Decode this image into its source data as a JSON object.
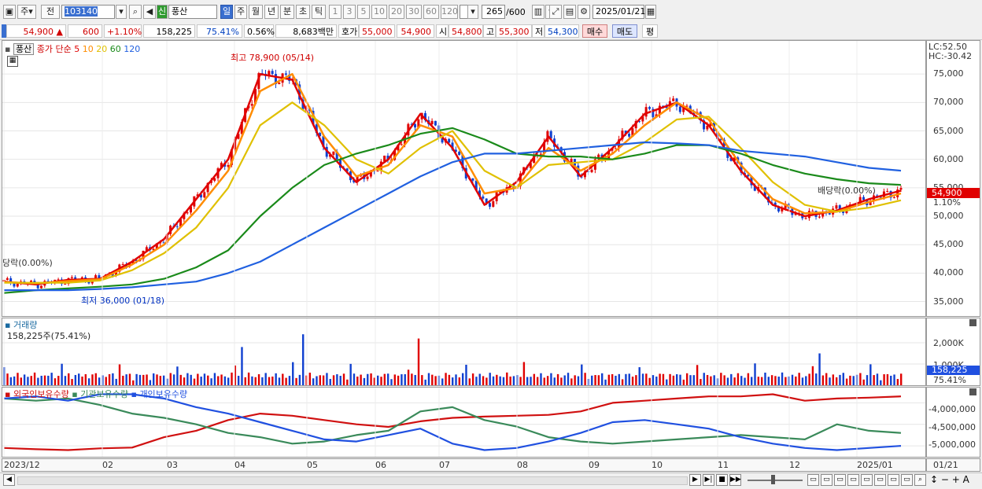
{
  "toolbar": {
    "market": "주",
    "period_prefix": "전",
    "stock_code": "103140",
    "new_badge": "신",
    "stock_name": "풍산",
    "periods": [
      "일",
      "주",
      "월",
      "년",
      "분",
      "초",
      "틱"
    ],
    "selected_period": "일",
    "intervals": [
      "1",
      "3",
      "5",
      "10",
      "20",
      "30",
      "60",
      "120"
    ],
    "count_display": "265",
    "count_total": "/600",
    "date": "2025/01/21"
  },
  "quote": {
    "price": "54,900",
    "change": "600",
    "change_pct": "+1.10%",
    "volume": "158,225",
    "volume_ratio": "75.41%",
    "turnover_pct": "0.56%",
    "amount": "8,683",
    "amount_unit": "백만",
    "ask_label": "호가",
    "ask1": "55,000",
    "ask2": "54,900",
    "open_label": "시",
    "open": "54,800",
    "high_label": "고",
    "high": "55,300",
    "low_label": "저",
    "low": "54,300",
    "buy_button": "매수",
    "sell_button": "매도",
    "eval_button": "평"
  },
  "price_panel": {
    "name_tag": "풍산",
    "legend_prefix": "종가 단순",
    "ma_periods": [
      "5",
      "10",
      "20",
      "60",
      "120"
    ],
    "ma_colors": [
      "#e00000",
      "#ff8c00",
      "#e0c000",
      "#1a8a1a",
      "#2060e0"
    ],
    "lc": "LC:52.50",
    "hc": "HC:-30.42",
    "high_annotation": "최고 78,900 (05/14)",
    "low_annotation": "최저 36,000 (01/18)",
    "dividend_left": "당락(0.00%)",
    "dividend_right": "배당락(0.00%)",
    "current_price_tag": "54,900",
    "current_pct_tag": "1.10%",
    "y_ticks": [
      "75,000",
      "70,000",
      "65,000",
      "60,000",
      "55,000",
      "50,000",
      "45,000",
      "40,000",
      "35,000"
    ]
  },
  "volume_panel": {
    "title": "거래량",
    "subtitle": "158,225주(75.41%)",
    "y_ticks": [
      "2,000K",
      "1,000K"
    ],
    "value_tag": "158,225",
    "pct_tag": "75.41%"
  },
  "holdings_panel": {
    "legend": [
      "외국인보유수량",
      "기관보유수량",
      "개인보유수량"
    ],
    "colors": [
      "#d01010",
      "#3a8a5a",
      "#2050e0"
    ],
    "y_ticks": [
      "-4,000,000",
      "-4,500,000",
      "-5,000,000"
    ]
  },
  "x_axis": {
    "labels": [
      "2023/12",
      "02",
      "03",
      "04",
      "05",
      "06",
      "07",
      "08",
      "09",
      "10",
      "11",
      "12",
      "2025/01"
    ],
    "right_label": "01/21"
  },
  "chart_data": {
    "type": "candlestick",
    "x_range": [
      "2023/12",
      "2025/01/21"
    ],
    "ylim": [
      33000,
      80000
    ],
    "ma_series": [
      {
        "name": "5",
        "values": [
          38500,
          38000,
          38800,
          39000,
          42000,
          46000,
          53000,
          60000,
          75000,
          74000,
          62000,
          56000,
          60000,
          68000,
          62000,
          52000,
          56000,
          64000,
          57000,
          62000,
          68000,
          70000,
          66000,
          58000,
          52000,
          50000,
          51000,
          53000,
          54500
        ]
      },
      {
        "name": "10",
        "values": [
          38400,
          38200,
          38600,
          38900,
          41500,
          45000,
          51000,
          58000,
          72000,
          75000,
          64000,
          57000,
          59000,
          66000,
          64000,
          54000,
          55000,
          62000,
          58000,
          61000,
          66000,
          70000,
          67000,
          59000,
          53000,
          50500,
          50800,
          52500,
          54000
        ]
      },
      {
        "name": "20",
        "values": [
          38300,
          38300,
          38300,
          38700,
          40500,
          43500,
          48000,
          55000,
          66000,
          70000,
          66000,
          60000,
          57500,
          62000,
          65000,
          58000,
          55000,
          59000,
          59500,
          60000,
          63000,
          67000,
          67500,
          62000,
          56000,
          52000,
          50800,
          51500,
          52800
        ]
      },
      {
        "name": "60",
        "values": [
          36500,
          37000,
          37300,
          37600,
          38000,
          39000,
          41000,
          44000,
          50000,
          55000,
          59000,
          61000,
          62500,
          64500,
          65500,
          63500,
          61000,
          60500,
          60500,
          60000,
          61000,
          62500,
          62500,
          61000,
          59000,
          57500,
          56500,
          55800,
          55500
        ]
      },
      {
        "name": "120",
        "values": [
          37000,
          37000,
          37000,
          37200,
          37500,
          38000,
          38500,
          40000,
          42000,
          45000,
          48000,
          51000,
          54000,
          57000,
          59500,
          61000,
          61000,
          61500,
          62000,
          62500,
          63000,
          62800,
          62500,
          61500,
          61000,
          60500,
          59500,
          58500,
          58000
        ]
      }
    ],
    "volume_peaks": [
      {
        "label": "05",
        "value": 2400000
      },
      {
        "label": "06",
        "value": 2200000
      },
      {
        "label": "12",
        "value": 1500000
      }
    ],
    "holdings_series": [
      {
        "name": "외국인보유수량",
        "values": [
          -5050000,
          -5080000,
          -5100000,
          -5060000,
          -5040000,
          -4800000,
          -4650000,
          -4400000,
          -4250000,
          -4300000,
          -4400000,
          -4500000,
          -4560000,
          -4430000,
          -4350000,
          -4320000,
          -4300000,
          -4280000,
          -4200000,
          -4000000,
          -3950000,
          -3900000,
          -3850000,
          -3850000,
          -3800000,
          -3950000,
          -3900000,
          -3880000,
          -3850000
        ]
      },
      {
        "name": "기관보유수량",
        "values": [
          -3900000,
          -3950000,
          -3900000,
          -4050000,
          -4250000,
          -4350000,
          -4500000,
          -4700000,
          -4800000,
          -4950000,
          -4900000,
          -4750000,
          -4650000,
          -4200000,
          -4100000,
          -4400000,
          -4550000,
          -4800000,
          -4900000,
          -4950000,
          -4900000,
          -4850000,
          -4800000,
          -4750000,
          -4800000,
          -4850000,
          -4500000,
          -4650000,
          -4700000
        ]
      },
      {
        "name": "개인보유수량",
        "values": [
          -3900000,
          -3850000,
          -3950000,
          -3800000,
          -3800000,
          -3900000,
          -4100000,
          -4250000,
          -4450000,
          -4650000,
          -4850000,
          -4900000,
          -4750000,
          -4600000,
          -4950000,
          -5100000,
          -5050000,
          -4900000,
          -4700000,
          -4450000,
          -4400000,
          -4500000,
          -4600000,
          -4800000,
          -4950000,
          -5050000,
          -5100000,
          -5050000,
          -5000000
        ]
      }
    ]
  }
}
